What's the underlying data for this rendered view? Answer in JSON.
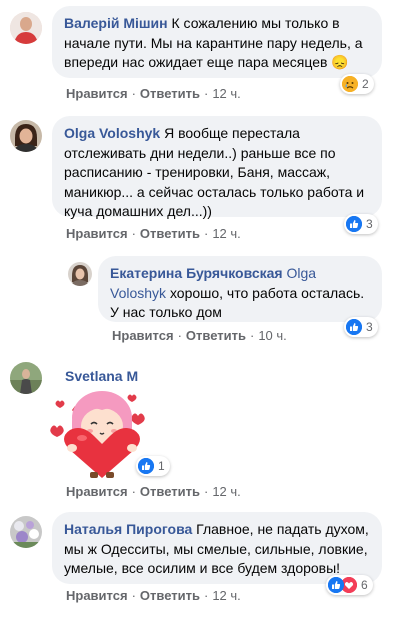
{
  "comments": [
    {
      "author": "Валерій Мішин",
      "text": "К сожалению мы только в начале пути. Мы на карантине пару недель, а впереди нас ожидает еще пара месяцев 😞",
      "like_label": "Нравится",
      "reply_label": "Ответить",
      "time": "12 ч.",
      "reaction_count": "2",
      "reaction_icons": [
        "sad-icon"
      ]
    },
    {
      "author": "Olga Voloshyk",
      "text": "Я вообще перестала отслеживать дни недели..) раньше все по расписанию - тренировки, Баня, массаж, маникюр... а сейчас осталась только работа и куча домашних дел...))",
      "like_label": "Нравится",
      "reply_label": "Ответить",
      "time": "12 ч.",
      "reaction_count": "3",
      "reaction_icons": [
        "like-icon"
      ]
    },
    {
      "author": "Екатерина Бурячковская",
      "mention": "Olga Voloshyk",
      "text": "хорошо, что работа осталась. У нас только дом",
      "like_label": "Нравится",
      "reply_label": "Ответить",
      "time": "10 ч.",
      "reaction_count": "3",
      "reaction_icons": [
        "like-icon"
      ]
    },
    {
      "author": "Svetlana M",
      "sticker": "girl-with-heart-sticker",
      "like_label": "Нравится",
      "reply_label": "Ответить",
      "time": "12 ч.",
      "reaction_count": "1",
      "reaction_icons": [
        "like-icon"
      ]
    },
    {
      "author": "Наталья Пирогова",
      "text": "Главное, не падать духом, мы ж Одесситы, мы смелые, сильные, ловкие, умелые, все осилим и все будем здоровы!",
      "like_label": "Нравится",
      "reply_label": "Ответить",
      "time": "12 ч.",
      "reaction_count": "6",
      "reaction_icons": [
        "like-icon",
        "love-icon"
      ]
    }
  ],
  "separator": "·",
  "colors": {
    "link": "#385898",
    "bubble": "#f0f2f5",
    "meta": "#65676b",
    "like": "#1877f2",
    "love": "#f33e58"
  }
}
